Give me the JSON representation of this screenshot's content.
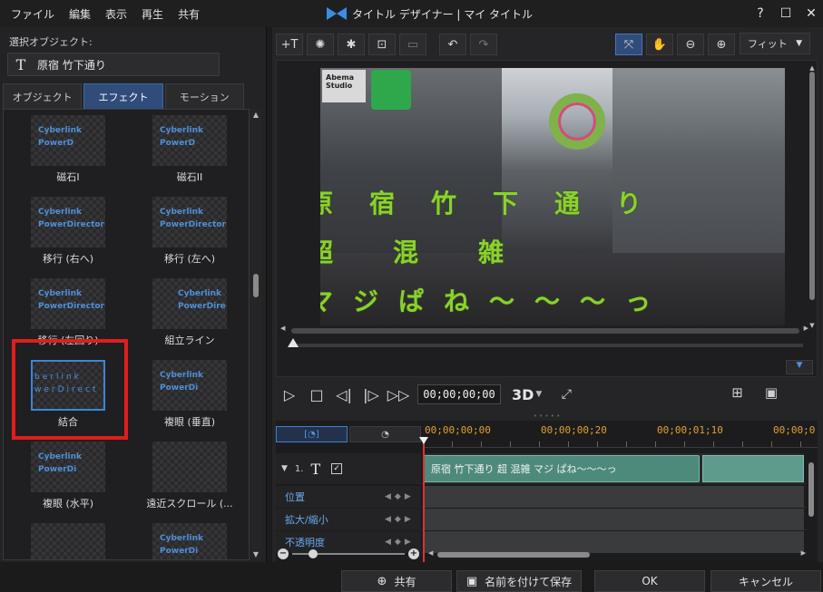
{
  "menu": [
    "ファイル",
    "編集",
    "表示",
    "再生",
    "共有"
  ],
  "window": {
    "title": "タイトル デザイナー | マイ タイトル"
  },
  "left": {
    "selected_label": "選択オブジェクト:",
    "selected_object": "原宿 竹下通り",
    "tabs": [
      "オブジェクト",
      "エフェクト",
      "モーション"
    ],
    "active_tab": "エフェクト",
    "effects": [
      {
        "name": "磁石I",
        "thumb": [
          "Cyberlink",
          "PowerD"
        ]
      },
      {
        "name": "磁石II",
        "thumb": [
          "Cyberlink",
          "PowerD"
        ]
      },
      {
        "name": "移行 (右へ)",
        "thumb": [
          "Cyberlink",
          "PowerDirector"
        ]
      },
      {
        "name": "移行 (左へ)",
        "thumb": [
          "Cyberlink",
          "PowerDirector"
        ]
      },
      {
        "name": "移行 (左回り)",
        "thumb": [
          "Cyberlink",
          "PowerDirector"
        ]
      },
      {
        "name": "組立ライン",
        "thumb": [
          "Cyberlink",
          "PowerDire"
        ]
      },
      {
        "name": "結合",
        "thumb": [
          "berlink",
          "werDirect"
        ]
      },
      {
        "name": "複眼 (垂直)",
        "thumb": [
          "Cyberlink",
          "PowerDi"
        ]
      },
      {
        "name": "複眼 (水平)",
        "thumb": [
          "Cyberlink",
          "PowerDi"
        ]
      },
      {
        "name": "遠近スクロール (...",
        "thumb": [
          "",
          ""
        ]
      },
      {
        "name": "",
        "thumb": [
          "",
          ""
        ]
      },
      {
        "name": "",
        "thumb": [
          "Cyberlink",
          "PowerDi"
        ]
      }
    ],
    "selected_effect": "結合"
  },
  "toolbar": {
    "fit_label": "フィット"
  },
  "preview": {
    "overlay_lines": [
      "原宿竹下通り",
      "超混雑",
      "マジぱね～～～っ"
    ],
    "sign_text": [
      "Abema",
      "Studio"
    ]
  },
  "playback": {
    "timecode": "00;00;00;00",
    "btn3d": "3D"
  },
  "timeline": {
    "ruler": [
      "00;00;00;00",
      "00;00;00;20",
      "00;00;01;10",
      "00;00;0"
    ],
    "track_number": "1.",
    "clip_text": "原宿 竹下通り 超 混雑 マジ ぱね～～～っ",
    "keyframe_rows": [
      "位置",
      "拡大/縮小",
      "不透明度"
    ]
  },
  "bottom": {
    "share_label": "共有",
    "save_as_label": "名前を付けて保存",
    "ok_label": "OK",
    "cancel_label": "キャンセル"
  }
}
